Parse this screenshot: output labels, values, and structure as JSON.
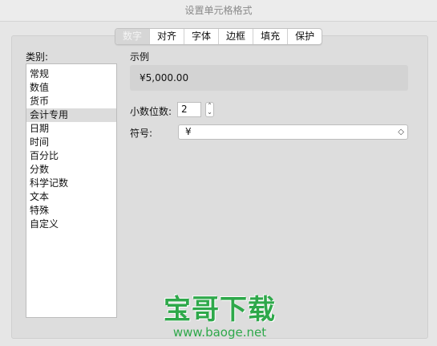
{
  "window": {
    "title": "设置单元格格式"
  },
  "tabs": [
    {
      "label": "数字",
      "active": true
    },
    {
      "label": "对齐",
      "active": false
    },
    {
      "label": "字体",
      "active": false
    },
    {
      "label": "边框",
      "active": false
    },
    {
      "label": "填充",
      "active": false
    },
    {
      "label": "保护",
      "active": false
    }
  ],
  "category": {
    "label": "类别:",
    "items": [
      "常规",
      "数值",
      "货币",
      "会计专用",
      "日期",
      "时间",
      "百分比",
      "分数",
      "科学记数",
      "文本",
      "特殊",
      "自定义"
    ],
    "selected_index": 3
  },
  "sample": {
    "label": "示例",
    "value": "¥5,000.00"
  },
  "decimal_places": {
    "label": "小数位数:",
    "value": "2",
    "stepper_up": "⌃",
    "stepper_down": "⌄"
  },
  "symbol": {
    "label": "符号:",
    "value": "¥",
    "chevron": "◇"
  },
  "watermark": {
    "title": "宝哥下载",
    "url": "www.baoge.net"
  },
  "colors": {
    "watermark_green": "#2ea84a",
    "selected_row": "#dcdcdc"
  }
}
